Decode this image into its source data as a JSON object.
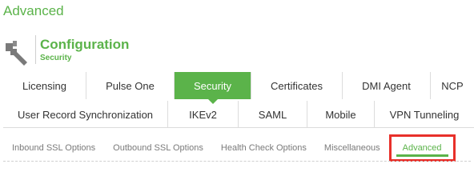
{
  "page": {
    "title": "Advanced"
  },
  "config": {
    "title": "Configuration",
    "subtitle": "Security"
  },
  "tabs_row1": [
    {
      "label": "Licensing"
    },
    {
      "label": "Pulse One"
    },
    {
      "label": "Security"
    },
    {
      "label": "Certificates"
    },
    {
      "label": "DMI Agent"
    },
    {
      "label": "NCP"
    }
  ],
  "tabs_row2": [
    {
      "label": "User Record Synchronization"
    },
    {
      "label": "IKEv2"
    },
    {
      "label": "SAML"
    },
    {
      "label": "Mobile"
    },
    {
      "label": "VPN Tunneling"
    }
  ],
  "subtabs": [
    {
      "label": "Inbound SSL Options"
    },
    {
      "label": "Outbound SSL Options"
    },
    {
      "label": "Health Check Options"
    },
    {
      "label": "Miscellaneous"
    },
    {
      "label": "Advanced"
    }
  ],
  "colors": {
    "accent": "#5bb34a",
    "highlight": "#e8302a"
  },
  "active": {
    "main_tab": "Security",
    "sub_tab": "Advanced"
  }
}
